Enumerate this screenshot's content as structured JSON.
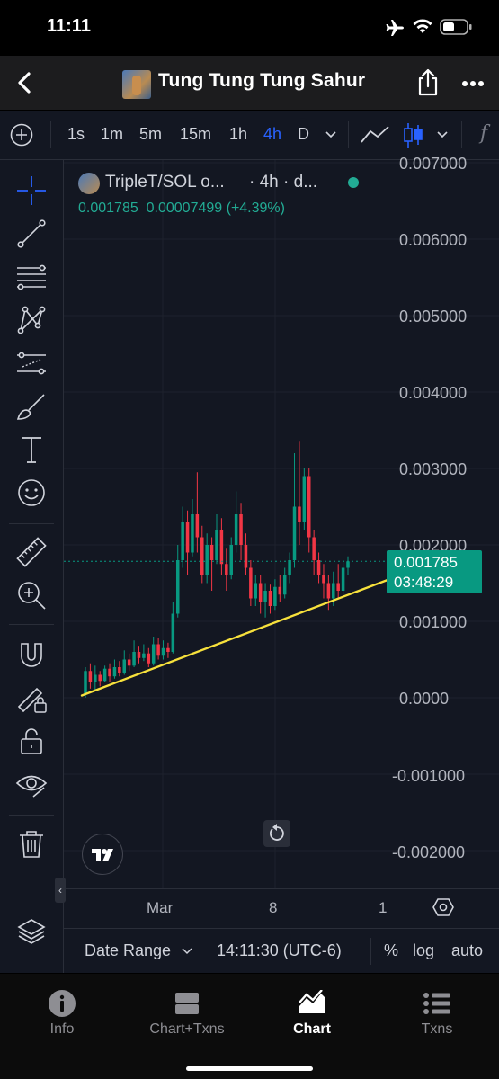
{
  "status_bar": {
    "time": "11:11"
  },
  "nav": {
    "title": "Tung Tung Tung Sahur"
  },
  "toolbar": {
    "intervals": [
      "1s",
      "1m",
      "5m",
      "15m",
      "1h",
      "4h",
      "D"
    ],
    "active_interval": "4h"
  },
  "legend": {
    "symbol": "TripleT/SOL o...",
    "interval": "· 4h · d...",
    "price": "0.001785",
    "change": "0.00007499",
    "change_pct": "(+4.39%)"
  },
  "price_label": {
    "price": "0.001785",
    "countdown": "03:48:29"
  },
  "y_axis": {
    "top_cut": "0.007000",
    "ticks": [
      "0.006000",
      "0.005000",
      "0.004000",
      "0.003000",
      "0.002000",
      "0.001000",
      "0.0000",
      "-0.001000",
      "-0.002000"
    ]
  },
  "x_axis": {
    "ticks": [
      "Mar",
      "8",
      "1"
    ]
  },
  "bottom_bar": {
    "date_range": "Date Range",
    "clock": "14:11:30 (UTC-6)",
    "percent": "%",
    "log": "log",
    "auto": "auto"
  },
  "tabs": [
    {
      "label": "Info"
    },
    {
      "label": "Chart+Txns"
    },
    {
      "label": "Chart",
      "active": true
    },
    {
      "label": "Txns"
    }
  ],
  "colors": {
    "up": "#089981",
    "down": "#f23645",
    "trendline": "#f7e13c",
    "accent": "#2962ff"
  },
  "chart_data": {
    "type": "candlestick",
    "ylim": [
      -0.0025,
      0.007
    ],
    "current_price": 0.001785,
    "candles": [
      [
        5e-05,
        0.00035,
        0.0,
        0.0004
      ],
      [
        0.00035,
        0.0002,
        0.00012,
        0.00045
      ],
      [
        0.0002,
        0.0003,
        0.0001,
        0.00042
      ],
      [
        0.0003,
        0.00022,
        0.00015,
        0.00035
      ],
      [
        0.00022,
        0.00038,
        0.0002,
        0.00042
      ],
      [
        0.00038,
        0.00028,
        0.0002,
        0.00045
      ],
      [
        0.00028,
        0.0004,
        0.00025,
        0.0005
      ],
      [
        0.0004,
        0.00032,
        0.00028,
        0.00048
      ],
      [
        0.00032,
        0.0005,
        0.0003,
        0.00062
      ],
      [
        0.0005,
        0.00042,
        0.00035,
        0.00058
      ],
      [
        0.00042,
        0.0006,
        0.0004,
        0.00075
      ],
      [
        0.0006,
        0.00052,
        0.00045,
        0.00068
      ],
      [
        0.00052,
        0.00058,
        0.00048,
        0.0007
      ],
      [
        0.00058,
        0.00045,
        0.0004,
        0.00065
      ],
      [
        0.00045,
        0.0007,
        0.00042,
        0.0008
      ],
      [
        0.0007,
        0.00055,
        0.0005,
        0.00078
      ],
      [
        0.00055,
        0.00065,
        0.0005,
        0.00075
      ],
      [
        0.00065,
        0.0006,
        0.00052,
        0.00072
      ],
      [
        0.0006,
        0.0011,
        0.00058,
        0.00125
      ],
      [
        0.0011,
        0.0018,
        0.00105,
        0.002
      ],
      [
        0.0018,
        0.0023,
        0.0017,
        0.0025
      ],
      [
        0.0023,
        0.0019,
        0.0016,
        0.00245
      ],
      [
        0.0019,
        0.0024,
        0.00185,
        0.0026
      ],
      [
        0.0024,
        0.0021,
        0.0019,
        0.00295
      ],
      [
        0.0021,
        0.0016,
        0.0015,
        0.00225
      ],
      [
        0.0016,
        0.002,
        0.0015,
        0.00215
      ],
      [
        0.002,
        0.0018,
        0.0014,
        0.0021
      ],
      [
        0.0018,
        0.0022,
        0.00175,
        0.0024
      ],
      [
        0.0022,
        0.00175,
        0.0016,
        0.00235
      ],
      [
        0.00175,
        0.0016,
        0.0014,
        0.00195
      ],
      [
        0.0016,
        0.002,
        0.00155,
        0.0021
      ],
      [
        0.002,
        0.0024,
        0.0019,
        0.0027
      ],
      [
        0.0024,
        0.002,
        0.0018,
        0.00255
      ],
      [
        0.002,
        0.0017,
        0.0016,
        0.00215
      ],
      [
        0.0017,
        0.0013,
        0.0012,
        0.0018
      ],
      [
        0.0013,
        0.0015,
        0.0012,
        0.0016
      ],
      [
        0.0015,
        0.00125,
        0.0011,
        0.0016
      ],
      [
        0.00125,
        0.0014,
        0.00105,
        0.0015
      ],
      [
        0.0014,
        0.0012,
        0.0011,
        0.00148
      ],
      [
        0.0012,
        0.00145,
        0.00115,
        0.00155
      ],
      [
        0.00145,
        0.00135,
        0.00125,
        0.0016
      ],
      [
        0.00135,
        0.0016,
        0.0013,
        0.0017
      ],
      [
        0.0016,
        0.0018,
        0.0015,
        0.0019
      ],
      [
        0.0018,
        0.0025,
        0.0017,
        0.0032
      ],
      [
        0.0025,
        0.0023,
        0.002,
        0.00335
      ],
      [
        0.0023,
        0.0029,
        0.0022,
        0.003
      ],
      [
        0.0029,
        0.0021,
        0.0019,
        0.003
      ],
      [
        0.0021,
        0.0018,
        0.0016,
        0.0022
      ],
      [
        0.0018,
        0.0016,
        0.0015,
        0.0019
      ],
      [
        0.0016,
        0.0015,
        0.0013,
        0.00175
      ],
      [
        0.0015,
        0.0013,
        0.00115,
        0.0016
      ],
      [
        0.0013,
        0.0015,
        0.0012,
        0.00165
      ],
      [
        0.0015,
        0.0014,
        0.0013,
        0.00175
      ],
      [
        0.0014,
        0.0017,
        0.00135,
        0.0018
      ],
      [
        0.0017,
        0.001785,
        0.0016,
        0.00185
      ]
    ],
    "trendline": [
      [
        0,
        3e-05
      ],
      [
        1,
        0.00155
      ]
    ]
  }
}
